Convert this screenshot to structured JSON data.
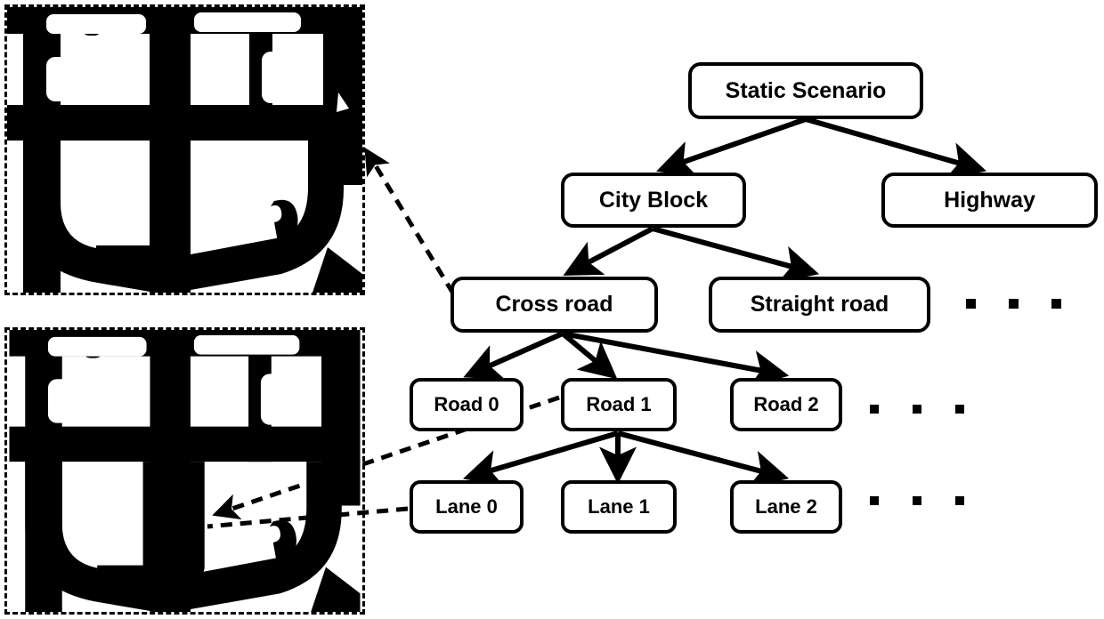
{
  "figure": {
    "kind": "hierarchy-diagram-with-map-insets",
    "background_color": "#ffffff",
    "line_color": "#000000"
  },
  "maps": {
    "road_color": "#000000",
    "ground_color": "#ffffff",
    "border_style": "dashed",
    "panels": [
      {
        "id": "map-top",
        "name": "city-block-overview-map",
        "alt": "Binary road-network map of a city block, dashed border",
        "highlight": "none"
      },
      {
        "id": "map-bottom",
        "name": "city-block-lane-highlight-map",
        "alt": "Same city block map with one vertical road segment highlighted as a lane",
        "highlight": "center-vertical-road"
      }
    ]
  },
  "tree": {
    "root": {
      "label": "Static Scenario"
    },
    "level2": [
      {
        "label": "City Block"
      },
      {
        "label": "Highway"
      }
    ],
    "level3": [
      {
        "label": "Cross road"
      },
      {
        "label": "Straight road"
      }
    ],
    "level4": [
      {
        "label": "Road 0"
      },
      {
        "label": "Road 1"
      },
      {
        "label": "Road 2"
      }
    ],
    "level5": [
      {
        "label": "Lane 0"
      },
      {
        "label": "Lane 1"
      },
      {
        "label": "Lane 2"
      }
    ],
    "ellipsis": {
      "glyph": "square-dot",
      "count": 3,
      "rows": [
        "level3-more",
        "level4-more",
        "level5-more"
      ]
    }
  },
  "edges": {
    "solid_arrows": [
      {
        "from": "Static Scenario",
        "to": "City Block"
      },
      {
        "from": "Static Scenario",
        "to": "Highway"
      },
      {
        "from": "City Block",
        "to": "Cross road"
      },
      {
        "from": "City Block",
        "to": "Straight road"
      },
      {
        "from": "Cross road",
        "to": "Road 0"
      },
      {
        "from": "Cross road",
        "to": "Road 1"
      },
      {
        "from": "Cross road",
        "to": "Road 2"
      },
      {
        "from": "Road 1",
        "to": "Lane 0"
      },
      {
        "from": "Road 1",
        "to": "Lane 1"
      },
      {
        "from": "Road 1",
        "to": "Lane 2"
      }
    ],
    "dashed_callouts": [
      {
        "from": "Cross road",
        "to": "map-top",
        "arrow": true
      },
      {
        "from": "Road 1",
        "to": "map-bottom",
        "arrow": true
      },
      {
        "from": "Lane 0",
        "to": "map-bottom",
        "arrow": false
      }
    ]
  }
}
